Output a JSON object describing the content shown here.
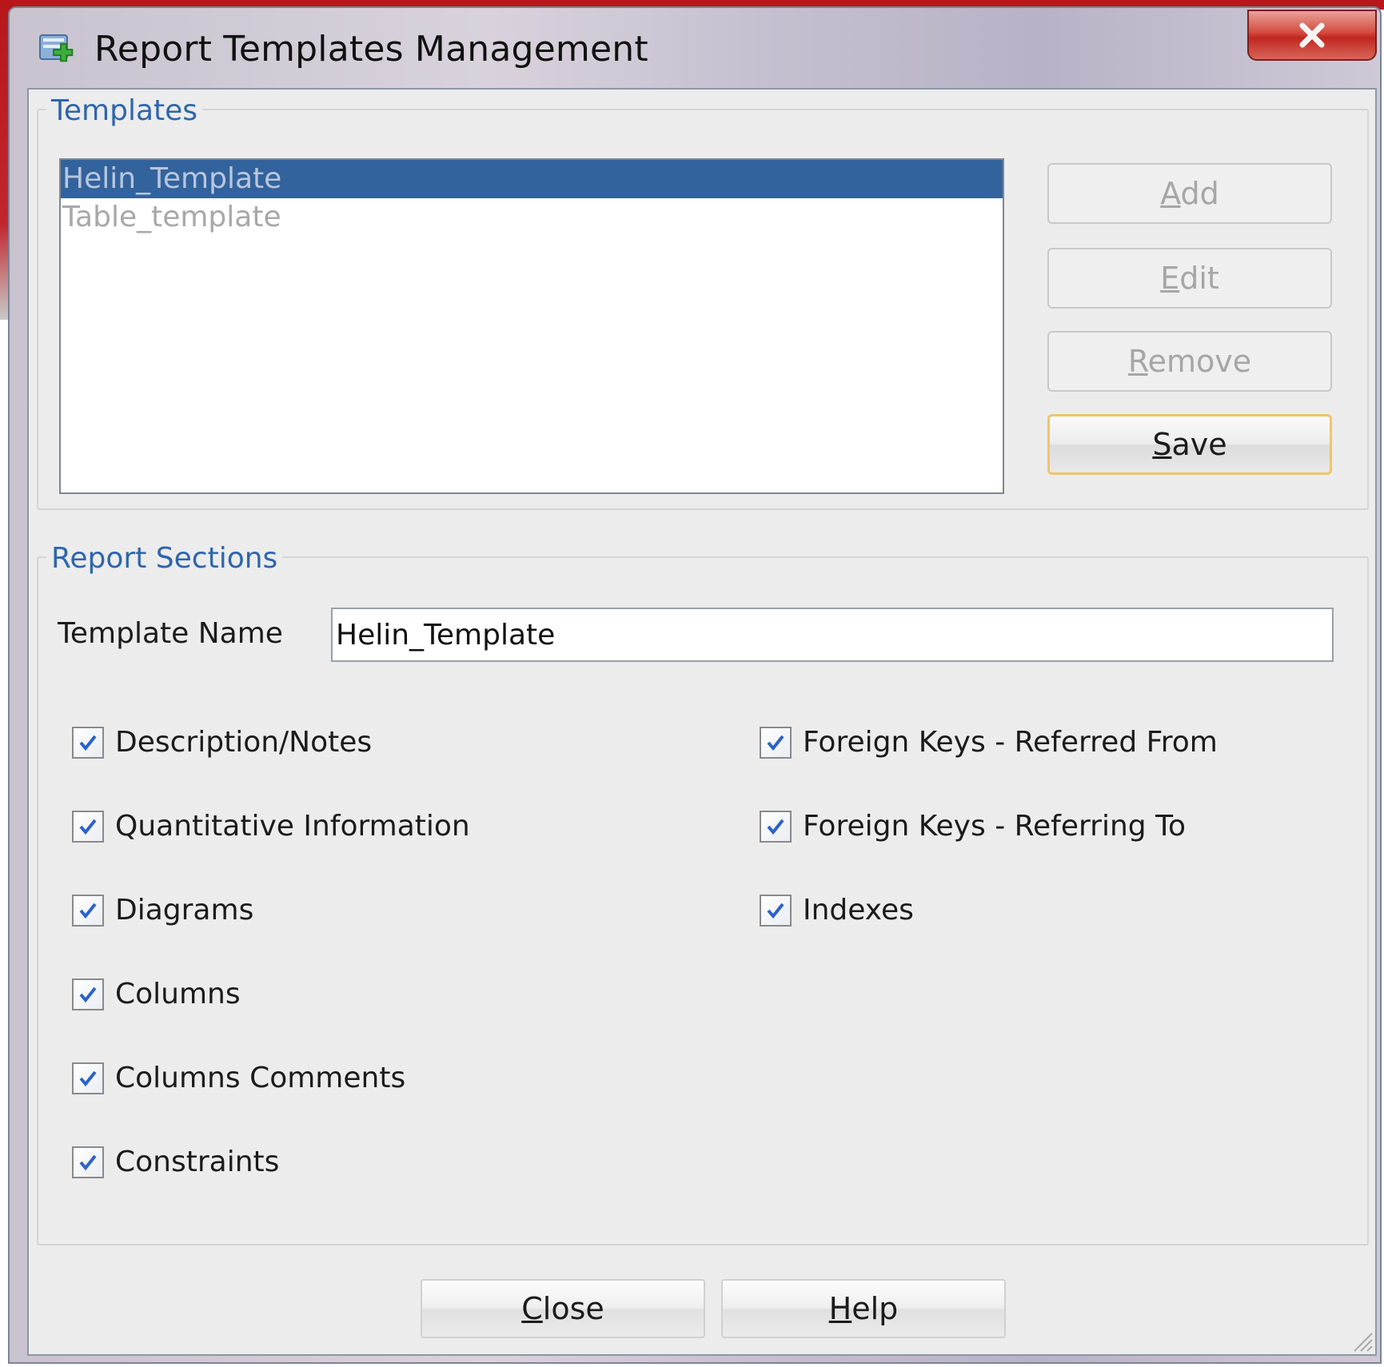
{
  "window": {
    "title": "Report Templates Management",
    "close_glyph": "X"
  },
  "templates_group": {
    "legend": "Templates",
    "items": [
      {
        "label": "Helin_Template",
        "selected": true
      },
      {
        "label": "Table_template",
        "selected": false
      }
    ],
    "buttons": {
      "add": {
        "pre": "",
        "key": "A",
        "post": "dd"
      },
      "edit": {
        "pre": "",
        "key": "E",
        "post": "dit"
      },
      "remove": {
        "pre": "",
        "key": "R",
        "post": "emove"
      },
      "save": {
        "pre": "",
        "key": "S",
        "post": "ave"
      }
    }
  },
  "sections_group": {
    "legend": "Report Sections",
    "template_name_label": "Template Name",
    "template_name_value": "Helin_Template",
    "checkboxes_left": [
      {
        "label": "Description/Notes",
        "checked": true
      },
      {
        "label": "Quantitative Information",
        "checked": true
      },
      {
        "label": "Diagrams",
        "checked": true
      },
      {
        "label": "Columns",
        "checked": true
      },
      {
        "label": "Columns Comments",
        "checked": true
      },
      {
        "label": "Constraints",
        "checked": true
      }
    ],
    "checkboxes_right": [
      {
        "label": "Foreign Keys - Referred From",
        "checked": true
      },
      {
        "label": "Foreign Keys - Referring To",
        "checked": true
      },
      {
        "label": "Indexes",
        "checked": true
      }
    ]
  },
  "footer": {
    "close": {
      "pre": "",
      "key": "C",
      "post": "lose"
    },
    "help": {
      "pre": "",
      "key": "H",
      "post": "elp"
    }
  },
  "colors": {
    "selection": "#33639d",
    "legend_text": "#2e65ad",
    "check_mark": "#2a62c9",
    "focus_border": "#f0c46a"
  },
  "icons": {
    "app": "report-template-app-icon",
    "close": "close-icon",
    "check": "check-icon",
    "grip": "resize-grip-icon"
  }
}
